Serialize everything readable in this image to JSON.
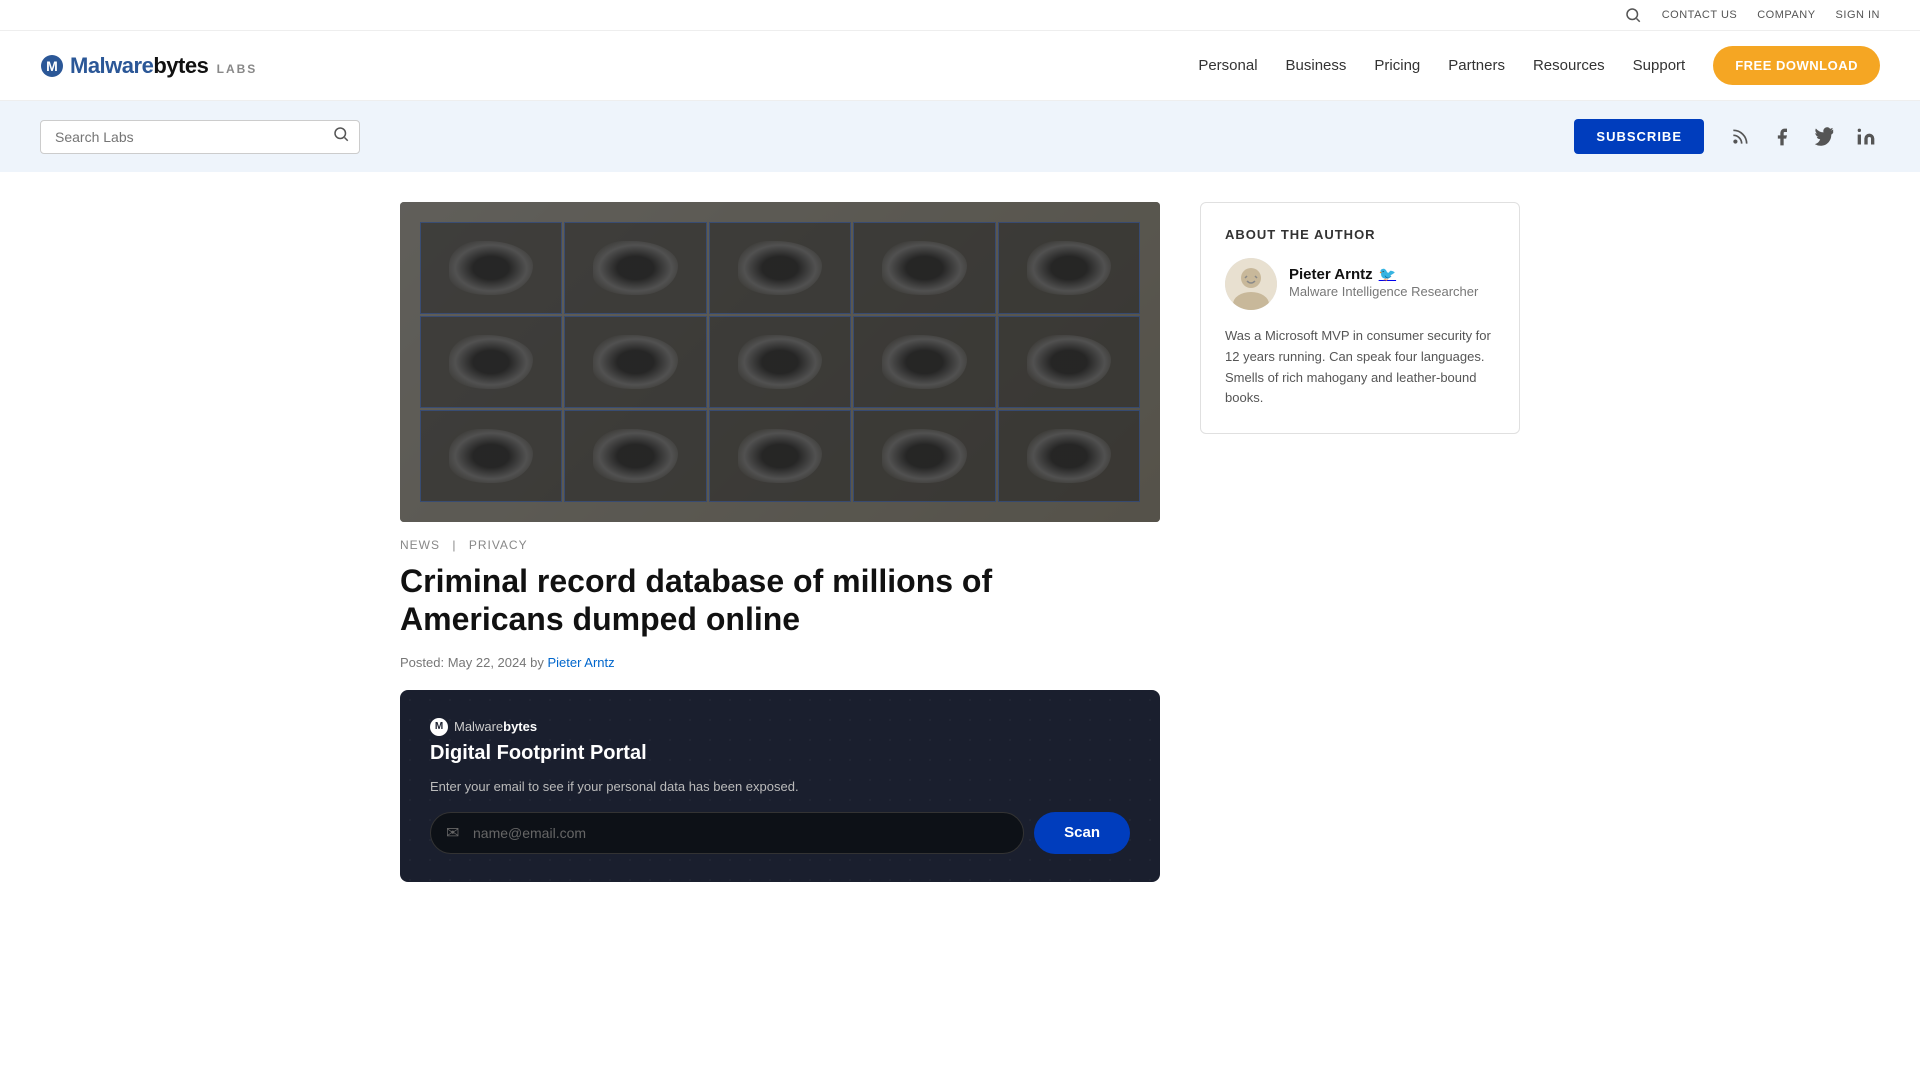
{
  "topbar": {
    "contact_us": "CONTACT US",
    "company": "COMPANY",
    "sign_in": "SIGN IN"
  },
  "nav": {
    "logo_mal": "Malware",
    "logo_bytes": "bytes",
    "logo_labs": "LABS",
    "links": [
      {
        "label": "Personal",
        "href": "#"
      },
      {
        "label": "Business",
        "href": "#"
      },
      {
        "label": "Pricing",
        "href": "#"
      },
      {
        "label": "Partners",
        "href": "#"
      },
      {
        "label": "Resources",
        "href": "#"
      },
      {
        "label": "Support",
        "href": "#"
      }
    ],
    "cta_label": "FREE DOWNLOAD"
  },
  "search": {
    "placeholder": "Search Labs",
    "subscribe_label": "SUBSCRIBE"
  },
  "article": {
    "tag1": "NEWS",
    "tag2": "PRIVACY",
    "title": "Criminal record database of millions of Americans dumped online",
    "meta": "Posted: May 22, 2024 by",
    "author_link": "Pieter Arntz"
  },
  "dfp": {
    "logo_text_plain": "Malware",
    "logo_text_bold": "bytes",
    "portal_title": "Digital Footprint Portal",
    "subtitle": "Enter your email to see if your personal data has been exposed.",
    "email_placeholder": "name@email.com",
    "scan_label": "Scan"
  },
  "sidebar": {
    "about_title": "ABOUT THE AUTHOR",
    "author_name": "Pieter Arntz",
    "author_role": "Malware Intelligence Researcher",
    "author_bio": "Was a Microsoft MVP in consumer security for 12 years running. Can speak four languages. Smells of rich mahogany and leather-bound books."
  }
}
